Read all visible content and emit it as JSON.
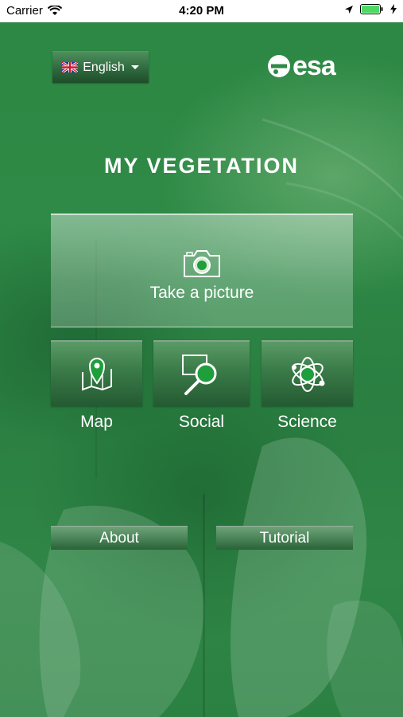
{
  "status_bar": {
    "carrier": "Carrier",
    "time": "4:20 PM"
  },
  "header": {
    "language": "English",
    "logo": "esa"
  },
  "title": "MY VEGETATION",
  "main": {
    "take_picture": "Take a picture",
    "tiles": [
      {
        "label": "Map",
        "icon": "map-pin-icon"
      },
      {
        "label": "Social",
        "icon": "magnifier-icon"
      },
      {
        "label": "Science",
        "icon": "atom-icon"
      }
    ]
  },
  "footer": {
    "about": "About",
    "tutorial": "Tutorial"
  },
  "colors": {
    "background": "#2f8a45",
    "accent": "#1f9e3c",
    "status_bar": "#ffffff"
  }
}
